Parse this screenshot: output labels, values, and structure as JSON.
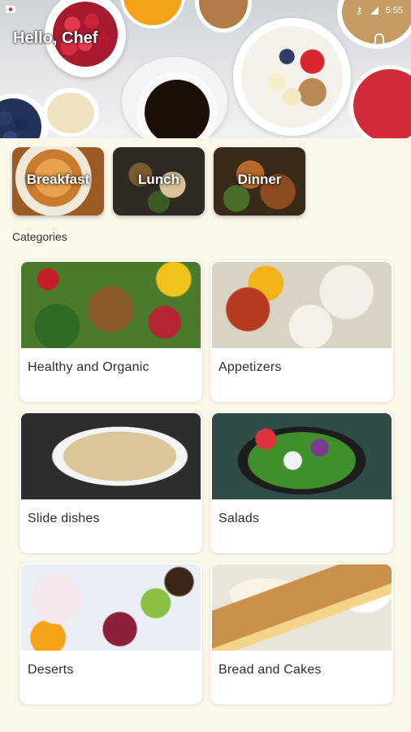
{
  "status_bar": {
    "time": "5:55",
    "icons": [
      "key-icon",
      "signal-icon"
    ]
  },
  "header": {
    "greeting": "Hello, Chef",
    "notification_icon": "bell-icon"
  },
  "meal_tabs": [
    {
      "label": "Breakfast"
    },
    {
      "label": "Lunch"
    },
    {
      "label": "Dinner"
    }
  ],
  "categories_title": "Categories",
  "categories": [
    {
      "label": "Healthy and Organic"
    },
    {
      "label": "Appetizers"
    },
    {
      "label": "Slide dishes"
    },
    {
      "label": "Salads"
    },
    {
      "label": "Deserts"
    },
    {
      "label": "Bread and Cakes"
    }
  ],
  "colors": {
    "background": "#fbf8ea",
    "card": "#ffffff",
    "text": "#2d2d2d"
  }
}
